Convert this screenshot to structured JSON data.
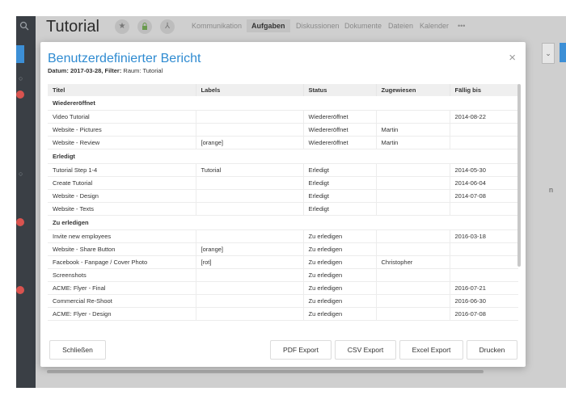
{
  "app": {
    "title": "Tutorial",
    "nav": [
      "Kommunikation",
      "Aufgaben",
      "Diskussionen",
      "Dokumente",
      "Dateien",
      "Kalender"
    ],
    "nav_active": "Aufgaben",
    "more": "•••",
    "side_text": "n"
  },
  "modal": {
    "title": "Benutzerdefinierter Bericht",
    "subtitle_date_label": "Datum:",
    "subtitle_date": "2017-03-28,",
    "subtitle_filter_label": "Filter:",
    "subtitle_filter": "Raum: Tutorial",
    "close": "×",
    "columns": [
      "Titel",
      "Labels",
      "Status",
      "Zugewiesen",
      "Fällig bis"
    ],
    "groups": [
      {
        "name": "Wiedereröffnet",
        "rows": [
          [
            "Video Tutorial",
            "",
            "Wiedereröffnet",
            "",
            "2014-08-22"
          ],
          [
            "Website - Pictures",
            "",
            "Wiedereröffnet",
            "Martin",
            ""
          ],
          [
            "Website - Review",
            "[orange]",
            "Wiedereröffnet",
            "Martin",
            ""
          ]
        ]
      },
      {
        "name": "Erledigt",
        "rows": [
          [
            "Tutorial Step 1-4",
            "Tutorial",
            "Erledigt",
            "",
            "2014-05-30"
          ],
          [
            "Create Tutorial",
            "",
            "Erledigt",
            "",
            "2014-06-04"
          ],
          [
            "Website - Design",
            "",
            "Erledigt",
            "",
            "2014-07-08"
          ],
          [
            "Website - Texts",
            "",
            "Erledigt",
            "",
            ""
          ]
        ]
      },
      {
        "name": "Zu erledigen",
        "rows": [
          [
            "Invite new employees",
            "",
            "Zu erledigen",
            "",
            "2016-03-18"
          ],
          [
            "Website - Share Button",
            "[orange]",
            "Zu erledigen",
            "",
            ""
          ],
          [
            "Facebook - Fanpage / Cover Photo",
            "[rot]",
            "Zu erledigen",
            "Christopher",
            ""
          ],
          [
            "Screenshots",
            "",
            "Zu erledigen",
            "",
            ""
          ],
          [
            "ACME: Flyer - Final",
            "",
            "Zu erledigen",
            "",
            "2016-07-21"
          ],
          [
            "Commercial Re-Shoot",
            "",
            "Zu erledigen",
            "",
            "2016-06-30"
          ],
          [
            "ACME: Flyer - Design",
            "",
            "Zu erledigen",
            "",
            "2016-07-08"
          ]
        ]
      }
    ],
    "buttons": {
      "close": "Schließen",
      "pdf": "PDF Export",
      "csv": "CSV Export",
      "excel": "Excel Export",
      "print": "Drucken"
    }
  }
}
